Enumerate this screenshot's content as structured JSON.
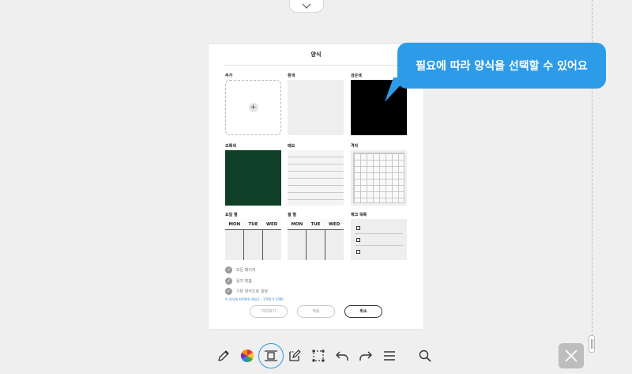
{
  "dialog": {
    "title": "양식",
    "tiles": [
      {
        "label": "추가"
      },
      {
        "label": "흰색"
      },
      {
        "label": "검은색"
      },
      {
        "label": "초록색"
      },
      {
        "label": "메모"
      },
      {
        "label": "격자"
      },
      {
        "label": "요일 별",
        "days": [
          "MON",
          "TUE",
          "WED"
        ]
      },
      {
        "label": "월 별",
        "days": [
          "MON",
          "TUE",
          "WED"
        ]
      },
      {
        "label": "체크 목록"
      }
    ],
    "add_symbol": "+",
    "options": [
      {
        "label": "모든 페이지"
      },
      {
        "label": "용지 맞춤"
      },
      {
        "label": "기본 양식으로 설정"
      }
    ],
    "hint": "이 양식에 최적화된 해상도 : 1760 X 1080",
    "buttons": {
      "preview": "미리보기",
      "apply": "적용",
      "cancel": "취소"
    }
  },
  "tooltip": {
    "text": "필요에 따라 양식을 선택할 수 있어요"
  },
  "colors": {
    "accent": "#2c9be8",
    "chalk_green": "#0f3f26",
    "black": "#000000"
  },
  "toolbar": {
    "icons": [
      "pencil-icon",
      "color-wheel-icon",
      "template-icon",
      "edit-page-icon",
      "select-icon",
      "undo-icon",
      "redo-icon",
      "menu-icon",
      "search-icon"
    ]
  }
}
